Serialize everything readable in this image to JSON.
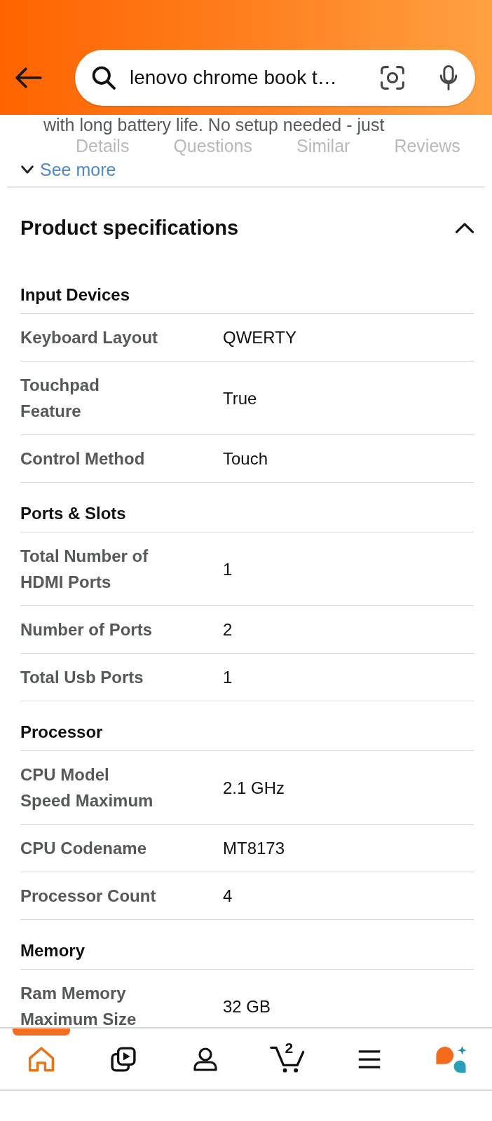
{
  "header": {
    "search": {
      "value": "lenovo chrome book t…"
    }
  },
  "description": {
    "text": "with long battery life. No setup needed - just",
    "see_more": "See more"
  },
  "section_tabs": [
    {
      "label": "Details",
      "selected": false
    },
    {
      "label": "Questions",
      "selected": false
    },
    {
      "label": "Similar",
      "selected": false
    },
    {
      "label": "Reviews",
      "selected": false
    }
  ],
  "specifications": {
    "title": "Product specifications",
    "expanded": true,
    "groups": [
      {
        "title": "Input Devices",
        "rows": [
          {
            "name": "Keyboard Layout",
            "value": "QWERTY"
          },
          {
            "name": "Touchpad Feature",
            "value": "True"
          },
          {
            "name": "Control Method",
            "value": "Touch"
          }
        ]
      },
      {
        "title": "Ports & Slots",
        "rows": [
          {
            "name": "Total Number of HDMI Ports",
            "value": "1"
          },
          {
            "name": "Number of Ports",
            "value": "2"
          },
          {
            "name": "Total Usb Ports",
            "value": "1"
          }
        ]
      },
      {
        "title": "Processor",
        "rows": [
          {
            "name": "CPU Model Speed Maximum",
            "value": "2.1 GHz"
          },
          {
            "name": "CPU Codename",
            "value": "MT8173"
          },
          {
            "name": "Processor Count",
            "value": "4"
          }
        ]
      },
      {
        "title": "Memory",
        "rows": [
          {
            "name": "Ram Memory Maximum Size",
            "value": "32 GB"
          }
        ]
      }
    ]
  },
  "bottom_nav": {
    "items": [
      {
        "kind": "home",
        "selected": true
      },
      {
        "kind": "video",
        "selected": false
      },
      {
        "kind": "account",
        "selected": false
      },
      {
        "kind": "cart",
        "selected": false,
        "count": "2"
      },
      {
        "kind": "menu",
        "selected": false
      },
      {
        "kind": "assistant",
        "selected": false
      }
    ]
  }
}
